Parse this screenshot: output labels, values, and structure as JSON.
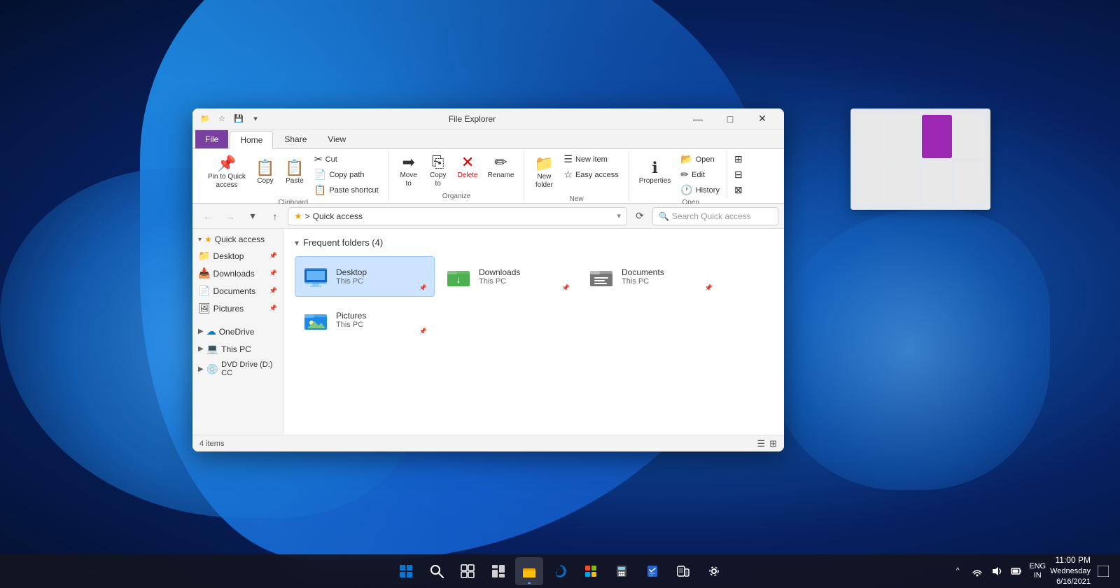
{
  "desktop": {
    "background": "Windows 11 blue swirl"
  },
  "window": {
    "title": "File Explorer",
    "title_bar_icons": [
      "folder-icon",
      "quick-access-icon",
      "save-icon",
      "arrow-icon"
    ],
    "minimize_label": "—",
    "maximize_label": "□",
    "close_label": "✕"
  },
  "ribbon": {
    "tabs": [
      {
        "label": "File",
        "active": false,
        "file": true
      },
      {
        "label": "Home",
        "active": true
      },
      {
        "label": "Share",
        "active": false
      },
      {
        "label": "View",
        "active": false
      }
    ],
    "groups": {
      "clipboard": {
        "label": "Clipboard",
        "pin_to_quick_access": "Pin to Quick\naccess",
        "copy": "Copy",
        "paste": "Paste",
        "cut": "Cut",
        "copy_path": "Copy path",
        "paste_shortcut": "Paste shortcut"
      },
      "organize": {
        "label": "Organize",
        "move_to": "Move\nto",
        "copy_to": "Copy\nto",
        "delete": "Delete",
        "rename": "Rename"
      },
      "new": {
        "label": "New",
        "new_folder": "New\nfolder",
        "new_item": "New item",
        "easy_access": "Easy access"
      },
      "open": {
        "label": "Open",
        "properties": "Properties",
        "open": "Open",
        "edit": "Edit",
        "history": "History"
      }
    }
  },
  "address_bar": {
    "back_tooltip": "Back",
    "forward_tooltip": "Forward",
    "recent_tooltip": "Recent locations",
    "up_tooltip": "Up",
    "path": "Quick access",
    "refresh_tooltip": "Refresh",
    "search_placeholder": "Search Quick access"
  },
  "sidebar": {
    "quick_access_label": "Quick access",
    "items": [
      {
        "label": "Desktop",
        "icon": "📁",
        "pinned": true
      },
      {
        "label": "Downloads",
        "icon": "📥",
        "pinned": true
      },
      {
        "label": "Documents",
        "icon": "📄",
        "pinned": true
      },
      {
        "label": "Pictures",
        "icon": "🖼",
        "pinned": true
      }
    ],
    "sections": [
      {
        "label": "OneDrive",
        "icon": "☁",
        "expanded": false
      },
      {
        "label": "This PC",
        "icon": "💻",
        "expanded": false
      },
      {
        "label": "DVD Drive (D:) CC",
        "icon": "💿",
        "expanded": false
      }
    ]
  },
  "main": {
    "section_title": "Frequent folders (4)",
    "folders": [
      {
        "name": "Desktop",
        "sub": "This PC",
        "pinned": true,
        "selected": true,
        "icon_type": "desktop"
      },
      {
        "name": "Downloads",
        "sub": "This PC",
        "pinned": true,
        "selected": false,
        "icon_type": "downloads"
      },
      {
        "name": "Documents",
        "sub": "This PC",
        "pinned": true,
        "selected": false,
        "icon_type": "documents"
      },
      {
        "name": "Pictures",
        "sub": "This PC",
        "pinned": true,
        "selected": false,
        "icon_type": "pictures"
      }
    ]
  },
  "status_bar": {
    "item_count": "4 items"
  },
  "taskbar": {
    "icons": [
      {
        "name": "start",
        "symbol": "⊞"
      },
      {
        "name": "search",
        "symbol": "🔍"
      },
      {
        "name": "task-view",
        "symbol": "❑"
      },
      {
        "name": "widgets",
        "symbol": "⊟"
      },
      {
        "name": "file-explorer",
        "symbol": "📁"
      },
      {
        "name": "edge",
        "symbol": "🌐"
      },
      {
        "name": "store",
        "symbol": "🏪"
      },
      {
        "name": "calculator",
        "symbol": "🖩"
      },
      {
        "name": "todo",
        "symbol": "✓"
      },
      {
        "name": "phone-link",
        "symbol": "📱"
      },
      {
        "name": "settings",
        "symbol": "⚙"
      }
    ],
    "tray": {
      "chevron": "^",
      "network": "🌐",
      "volume": "🔊",
      "battery": "🔋",
      "lang": "ENG\nIN"
    },
    "time": "11:00 PM",
    "date": "Wednesday\n6/16/2021"
  },
  "thumbnail_panel": {
    "cells": [
      {
        "type": "light"
      },
      {
        "type": "light"
      },
      {
        "type": "purple"
      },
      {
        "type": "light"
      },
      {
        "type": "light"
      },
      {
        "type": "light"
      },
      {
        "type": "light"
      },
      {
        "type": "light"
      }
    ]
  }
}
